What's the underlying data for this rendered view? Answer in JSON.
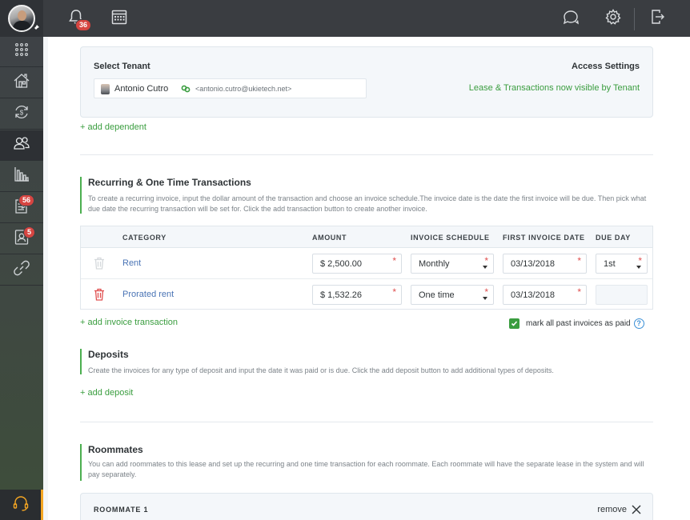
{
  "header": {
    "notifications_count": "36"
  },
  "sidebar": {
    "items": [
      {
        "name": "apps",
        "badge": null
      },
      {
        "name": "properties",
        "badge": null
      },
      {
        "name": "transactions",
        "badge": null
      },
      {
        "name": "tenants",
        "badge": null,
        "active": true
      },
      {
        "name": "reports",
        "badge": null
      },
      {
        "name": "documents",
        "badge": "56"
      },
      {
        "name": "contacts",
        "badge": "5"
      },
      {
        "name": "integrations",
        "badge": null
      }
    ]
  },
  "tenant": {
    "select_label": "Select Tenant",
    "access_label": "Access Settings",
    "name": "Antonio Cutro",
    "email": "<antonio.cutro@ukietech.net>",
    "access_value": "Lease & Transactions now visible by Tenant",
    "add_dependent": "+ add dependent"
  },
  "transactions": {
    "title": "Recurring & One Time Transactions",
    "description": "To create a recurring invoice, input the dollar amount of the transaction and choose an invoice schedule.The invoice date is the date the first invoice will be due. Then pick what due date the recurring transaction will be set for. Click the add transaction button to create another invoice.",
    "columns": {
      "category": "CATEGORY",
      "amount": "AMOUNT",
      "schedule": "INVOICE SCHEDULE",
      "first_date": "FIRST INVOICE DATE",
      "due_day": "DUE DAY"
    },
    "rows": [
      {
        "category": "Rent",
        "amount": "$ 2,500.00",
        "schedule": "Monthly",
        "first_date": "03/13/2018",
        "due_day": "1st"
      },
      {
        "category": "Prorated rent",
        "amount": "$ 1,532.26",
        "schedule": "One time",
        "first_date": "03/13/2018",
        "due_day": ""
      }
    ],
    "add_invoice": "+ add invoice transaction",
    "mark_paid": "mark all past invoices as paid",
    "help": "?"
  },
  "deposits": {
    "title": "Deposits",
    "description": "Create the invoices for any type of deposit and input the date it was paid or is due. Click the add deposit button to add additional types of deposits.",
    "add_deposit": "+ add deposit"
  },
  "roommates": {
    "title": "Roommates",
    "description": "You can add roommates to this lease and set up the recurring and one time transaction for each roommate. Each roommate will have the separate lease in the system and will pay separately.",
    "roommate_label": "ROOMMATE 1",
    "remove_label": "remove"
  },
  "required_mark": "*",
  "colors": {
    "accent_green": "#3a9d3f",
    "link_blue": "#4a74b5",
    "badge_red": "#d64541",
    "topbar": "#3a3d41"
  }
}
